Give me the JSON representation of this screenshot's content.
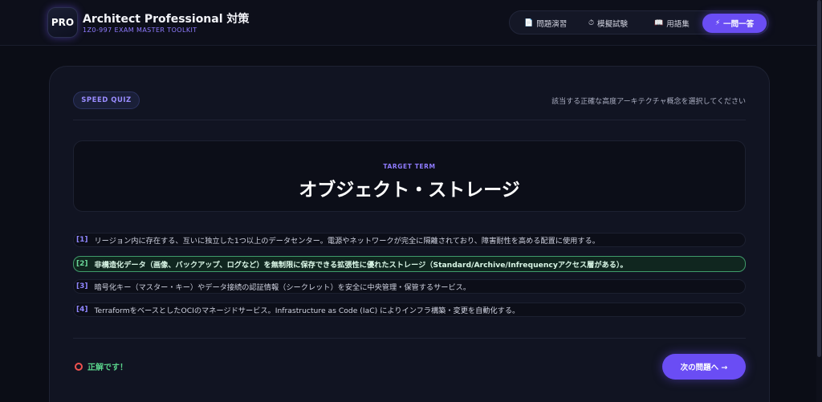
{
  "header": {
    "logo_text": "PRO",
    "title": "Architect Professional 対策",
    "subtitle": "1Z0-997 EXAM MASTER TOOLKIT",
    "nav": [
      {
        "label": "問題演習",
        "icon": "document-icon",
        "glyph": "📄"
      },
      {
        "label": "模擬試験",
        "icon": "timer-icon",
        "glyph": "⏱"
      },
      {
        "label": "用語集",
        "icon": "book-icon",
        "glyph": "📖"
      },
      {
        "label": "一問一答",
        "icon": "lightning-icon",
        "glyph": "⚡",
        "active": true
      }
    ]
  },
  "quiz": {
    "badge": "SPEED QUIZ",
    "instruction": "該当する正確な高度アーキテクチャ概念を選択してください",
    "target_label": "TARGET TERM",
    "term": "オブジェクト・ストレージ",
    "options": [
      {
        "num": "[1]",
        "text": "リージョン内に存在する、互いに独立した1つ以上のデータセンター。電源やネットワークが完全に隔離されており、障害耐性を高める配置に使用する。"
      },
      {
        "num": "[2]",
        "text": "非構造化データ（画像、バックアップ、ログなど）を無制限に保存できる拡張性に優れたストレージ（Standard/Archive/Infrequencyアクセス層がある）。",
        "selected": true,
        "correct": true
      },
      {
        "num": "[3]",
        "text": "暗号化キー（マスター・キー）やデータ接続の認証情報（シークレット）を安全に中央管理・保管するサービス。"
      },
      {
        "num": "[4]",
        "text": "TerraformをベースとしたOCIのマネージドサービス。Infrastructure as Code (IaC) によりインフラ構築・変更を自動化する。"
      }
    ],
    "result": "正解です！",
    "result_icon": "correct-circle-icon",
    "next_button": "次の問題へ →"
  },
  "colors": {
    "accent": "#6a4df4",
    "correct": "#59d18a",
    "background": "#0b0d16"
  }
}
